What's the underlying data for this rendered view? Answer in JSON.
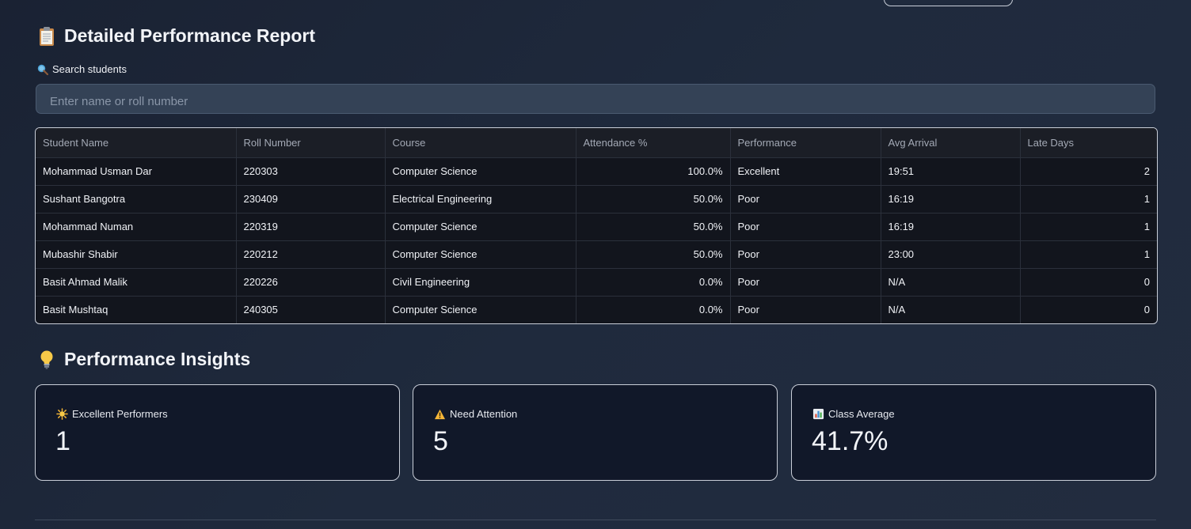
{
  "report": {
    "title": "Detailed Performance Report",
    "title_icon": "clipboard-icon",
    "search": {
      "label": "Search students",
      "label_icon": "magnifier-icon",
      "placeholder": "Enter name or roll number",
      "value": ""
    },
    "table": {
      "columns": [
        "Student Name",
        "Roll Number",
        "Course",
        "Attendance %",
        "Performance",
        "Avg Arrival",
        "Late Days"
      ],
      "rows": [
        [
          "Mohammad Usman Dar",
          "220303",
          "Computer Science",
          "100.0%",
          "Excellent",
          "19:51",
          "2"
        ],
        [
          "Sushant Bangotra",
          "230409",
          "Electrical Engineering",
          "50.0%",
          "Poor",
          "16:19",
          "1"
        ],
        [
          "Mohammad Numan",
          "220319",
          "Computer Science",
          "50.0%",
          "Poor",
          "16:19",
          "1"
        ],
        [
          "Mubashir Shabir",
          "220212",
          "Computer Science",
          "50.0%",
          "Poor",
          "23:00",
          "1"
        ],
        [
          "Basit Ahmad Malik",
          "220226",
          "Civil Engineering",
          "0.0%",
          "Poor",
          "N/A",
          "0"
        ],
        [
          "Basit Mushtaq",
          "240305",
          "Computer Science",
          "0.0%",
          "Poor",
          "N/A",
          "0"
        ]
      ]
    }
  },
  "insights": {
    "title": "Performance Insights",
    "title_icon": "lightbulb-icon",
    "cards": [
      {
        "label": "Excellent Performers",
        "icon": "sun-icon",
        "value": "1"
      },
      {
        "label": "Need Attention",
        "icon": "warning-icon",
        "value": "5"
      },
      {
        "label": "Class Average",
        "icon": "bar-chart-icon",
        "value": "41.7%"
      }
    ]
  }
}
